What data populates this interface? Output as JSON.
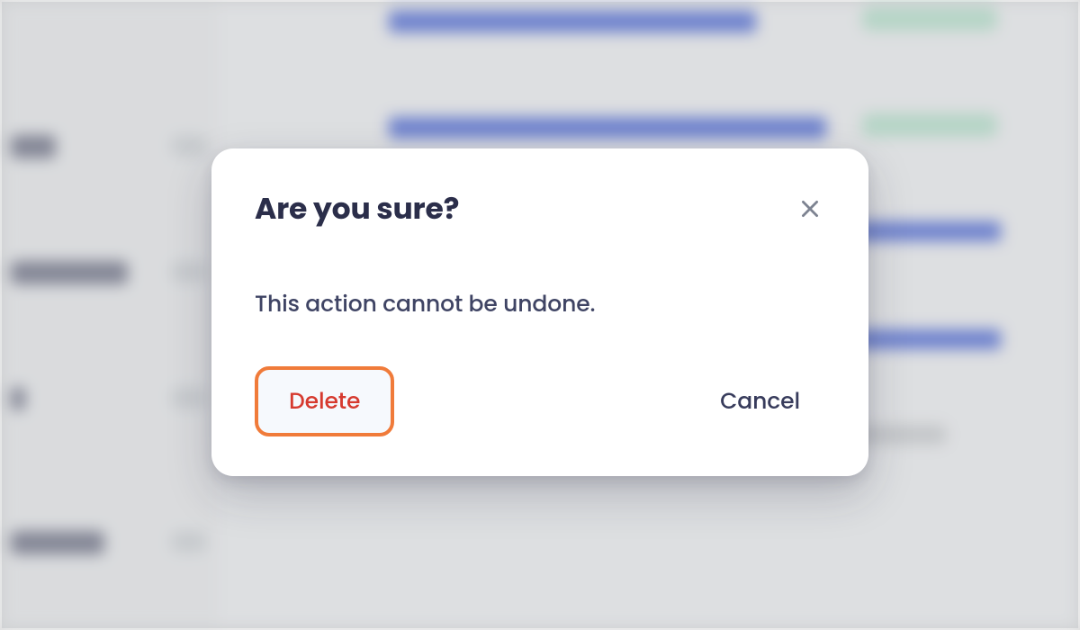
{
  "modal": {
    "title": "Are you sure?",
    "body": "This action cannot be undone.",
    "buttons": {
      "delete": "Delete",
      "cancel": "Cancel"
    }
  }
}
